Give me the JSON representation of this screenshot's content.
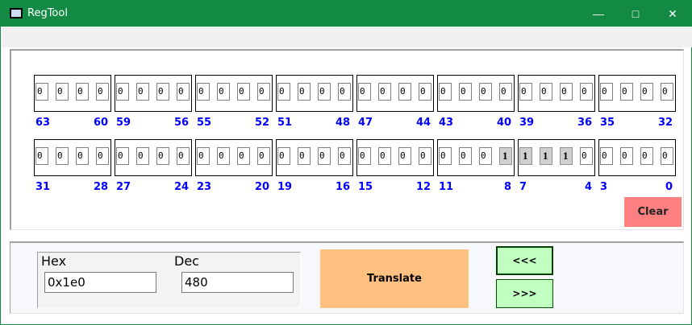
{
  "window": {
    "title": "RegTool",
    "minimize_icon": "minimize-icon",
    "maximize_icon": "maximize-icon",
    "close_icon": "close-icon"
  },
  "bits": {
    "rows": [
      {
        "groups": [
          {
            "high": "63",
            "low": "60",
            "values": [
              "0",
              "0",
              "0",
              "0"
            ]
          },
          {
            "high": "59",
            "low": "56",
            "values": [
              "0",
              "0",
              "0",
              "0"
            ]
          },
          {
            "high": "55",
            "low": "52",
            "values": [
              "0",
              "0",
              "0",
              "0"
            ]
          },
          {
            "high": "51",
            "low": "48",
            "values": [
              "0",
              "0",
              "0",
              "0"
            ]
          },
          {
            "high": "47",
            "low": "44",
            "values": [
              "0",
              "0",
              "0",
              "0"
            ]
          },
          {
            "high": "43",
            "low": "40",
            "values": [
              "0",
              "0",
              "0",
              "0"
            ]
          },
          {
            "high": "39",
            "low": "36",
            "values": [
              "0",
              "0",
              "0",
              "0"
            ]
          },
          {
            "high": "35",
            "low": "32",
            "values": [
              "0",
              "0",
              "0",
              "0"
            ]
          }
        ]
      },
      {
        "groups": [
          {
            "high": "31",
            "low": "28",
            "values": [
              "0",
              "0",
              "0",
              "0"
            ]
          },
          {
            "high": "27",
            "low": "24",
            "values": [
              "0",
              "0",
              "0",
              "0"
            ]
          },
          {
            "high": "23",
            "low": "20",
            "values": [
              "0",
              "0",
              "0",
              "0"
            ]
          },
          {
            "high": "19",
            "low": "16",
            "values": [
              "0",
              "0",
              "0",
              "0"
            ]
          },
          {
            "high": "15",
            "low": "12",
            "values": [
              "0",
              "0",
              "0",
              "0"
            ]
          },
          {
            "high": "11",
            "low": "8",
            "values": [
              "0",
              "0",
              "0",
              "1"
            ]
          },
          {
            "high": "7",
            "low": "4",
            "values": [
              "1",
              "1",
              "1",
              "0"
            ]
          },
          {
            "high": "3",
            "low": "0",
            "values": [
              "0",
              "0",
              "0",
              "0"
            ]
          }
        ]
      }
    ]
  },
  "clear_label": "Clear",
  "hex": {
    "label": "Hex",
    "value": "0x1e0"
  },
  "dec": {
    "label": "Dec",
    "value": "480"
  },
  "translate_label": "Translate",
  "shift_left_label": "<<<",
  "shift_right_label": ">>>",
  "colors": {
    "titlebar": "#138a43",
    "bit_label": "#0000ff",
    "clear": "#ff8080",
    "translate": "#ffc080",
    "shift": "#c0ffc0"
  }
}
